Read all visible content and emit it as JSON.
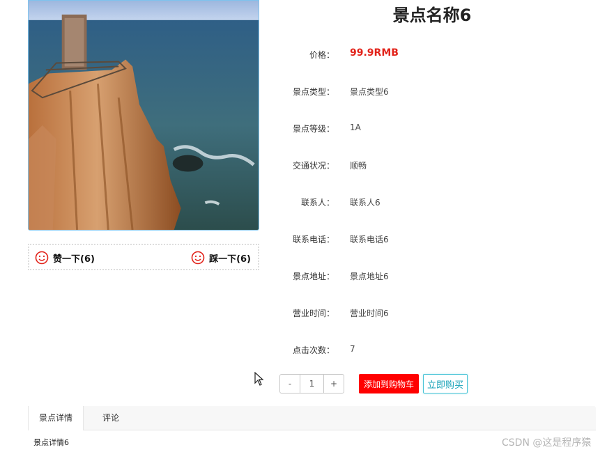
{
  "title": "景点名称6",
  "info": [
    {
      "label": "价格：",
      "value": "99.9RMB"
    },
    {
      "label": "景点类型：",
      "value": "景点类型6"
    },
    {
      "label": "景点等级：",
      "value": "1A"
    },
    {
      "label": "交通状况：",
      "value": "顺畅"
    },
    {
      "label": "联系人：",
      "value": "联系人6"
    },
    {
      "label": "联系电话：",
      "value": "联系电话6"
    },
    {
      "label": "景点地址：",
      "value": "景点地址6"
    },
    {
      "label": "营业时间：",
      "value": "营业时间6"
    },
    {
      "label": "点击次数：",
      "value": "7"
    }
  ],
  "vote": {
    "like_label": "赞一下(6)",
    "dislike_label": "踩一下(6)"
  },
  "quantity": {
    "minus": "-",
    "value": "1",
    "plus": "+"
  },
  "buttons": {
    "add_to_cart": "添加到购物车",
    "buy_now": "立即购买"
  },
  "tabs": [
    {
      "label": "景点详情",
      "active": true
    },
    {
      "label": "评论",
      "active": false
    }
  ],
  "tab_content": "景点详情6",
  "watermark": "CSDN @这是程序猿",
  "colors": {
    "price": "#e2231a",
    "cart_button": "#ff0000",
    "buy_button_border": "#46c3d6",
    "image_border": "#7ec3ee"
  },
  "icons": {
    "vote": "smiley-face-icon",
    "cursor": "mouse-pointer-icon"
  }
}
